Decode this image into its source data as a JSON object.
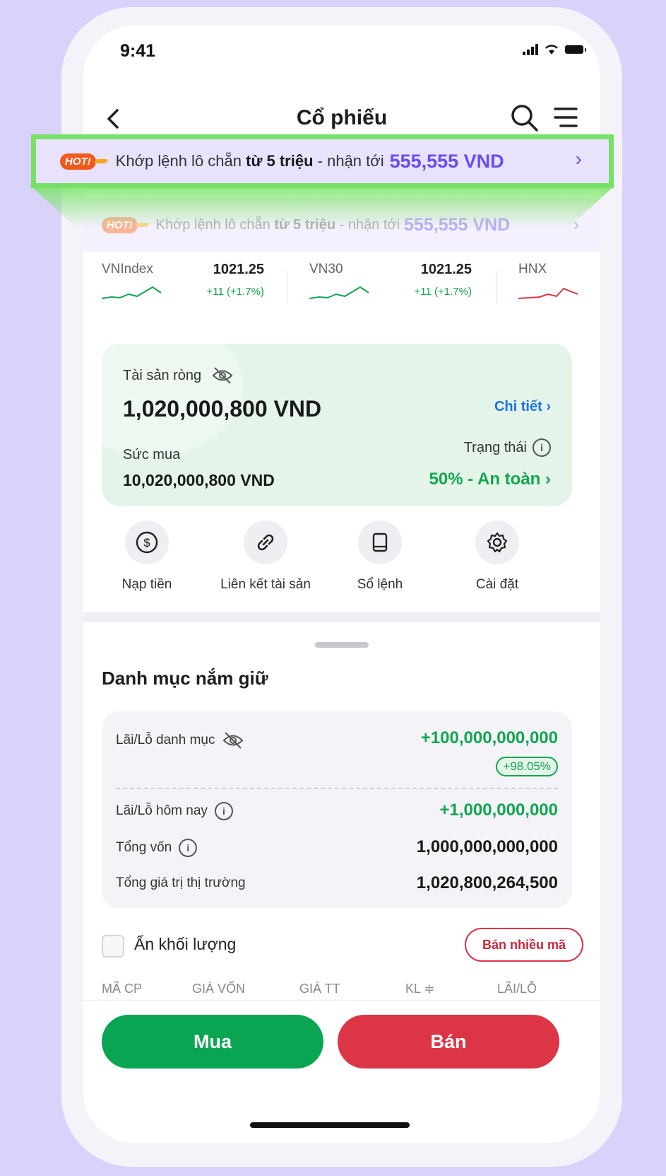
{
  "status_bar": {
    "time": "9:41"
  },
  "header": {
    "title": "Cổ phiếu"
  },
  "banner": {
    "hot_label": "HOT!",
    "text_pre": "Khớp lệnh lô chẵn",
    "text_bold": "từ 5 triệu",
    "text_mid": "- nhận tới",
    "amount": "555,555 VND"
  },
  "indices": [
    {
      "name": "VNIndex",
      "value": "1021.25",
      "change": "+11 (+1.7%)",
      "trend": "up"
    },
    {
      "name": "VN30",
      "value": "1021.25",
      "change": "+11 (+1.7%)",
      "trend": "up"
    },
    {
      "name": "HNX",
      "value": "",
      "change": "",
      "trend": "down"
    }
  ],
  "asset": {
    "net_label": "Tài sản ròng",
    "net_value": "1,020,000,800 VND",
    "detail_link": "Chi tiết",
    "buying_power_label": "Sức mua",
    "buying_power_value": "10,020,000,800 VND",
    "status_label": "Trạng thái",
    "status_value": "50% - An toàn"
  },
  "quick_actions": [
    {
      "label": "Nạp tiền",
      "icon": "dollar-icon"
    },
    {
      "label": "Liên kết tài sản",
      "icon": "link-icon"
    },
    {
      "label": "Sổ lệnh",
      "icon": "book-icon"
    },
    {
      "label": "Cài đặt",
      "icon": "gear-icon"
    }
  ],
  "portfolio": {
    "section_title": "Danh mục nắm giữ",
    "pnl_label": "Lãi/Lỗ danh mục",
    "pnl_value": "+100,000,000,000",
    "pnl_pct": "+98.05%",
    "today_label": "Lãi/Lỗ hôm nay",
    "today_value": "+1,000,000,000",
    "capital_label": "Tổng vốn",
    "capital_value": "1,000,000,000,000",
    "market_label": "Tổng giá trị thị trường",
    "market_value": "1,020,800,264,500"
  },
  "controls": {
    "hide_volume_label": "Ẩn khối lượng",
    "sell_multi_label": "Bán nhiều mã"
  },
  "table": {
    "columns": [
      "MÃ CP",
      "GIÁ VỐN",
      "GIÁ TT",
      "KL ≑",
      "LÃI/LỖ"
    ]
  },
  "actions": {
    "buy": "Mua",
    "sell": "Bán"
  },
  "colors": {
    "accent": "#6a4cf4",
    "green": "#0aa552",
    "red": "#dc3545",
    "highlight": "#76e067"
  }
}
